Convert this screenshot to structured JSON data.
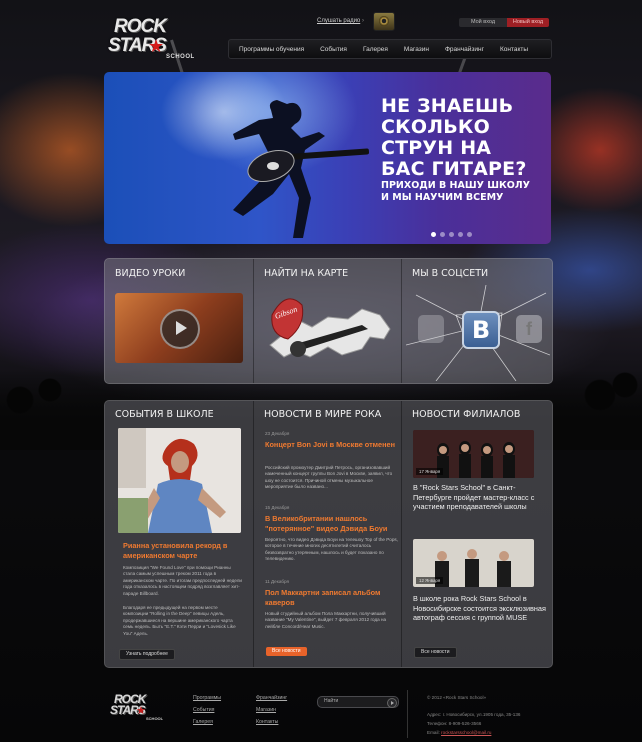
{
  "brand": {
    "logo_line1": "ROCK",
    "logo_line2": "STARS",
    "logo_school": "SCHOOL",
    "accent": "#f07a30",
    "red": "#9e1f24"
  },
  "header": {
    "radio_link": "Слушать радио",
    "auth_login": "Мой вход",
    "auth_register": "Новый вход",
    "nav": [
      "Программы обучения",
      "События",
      "Галерея",
      "Магазин",
      "Франчайзинг",
      "Контакты"
    ]
  },
  "hero": {
    "headline": [
      "НЕ ЗНАЕШЬ",
      "СКОЛЬКО",
      "СТРУН НА",
      "БАС ГИТАРЕ?"
    ],
    "subline": [
      "ПРИХОДИ В НАШУ ШКОЛУ",
      "И МЫ НАУЧИМ ВСЕМУ"
    ],
    "slides_total": 5,
    "active_slide": 1
  },
  "features": {
    "video_title": "ВИДЕО УРОКИ",
    "map_title": "НАЙТИ НА КАРТЕ",
    "social_title": "МЫ В СОЦСЕТИ",
    "map_badge": "Gibson",
    "vk_letter": "B",
    "fb_letter": "f"
  },
  "events": {
    "title": "СОБЫТИЯ В ШКОЛЕ",
    "item_title": "Рианна установила рекорд в американском чарте",
    "text1": "Композиция \"We Found Love\" при помощи Рианны стала самым успешным треком 2011 года в американском чарте. По итогам предпоследней недели года отказалось в настоящем подряд возглавляет хит-параде Billboard.",
    "text2": "Благодаря ее предыдущей на первом месте композиции \"Rolling in the Deep\" певицы Адель, продержавшиеся на вершине американского чарта семь недель. Быть \"E.T.\" Кэти Перри и \"Lovesick Like You\" Адель.",
    "button": "Узнать подробнее"
  },
  "news": {
    "title": "НОВОСТИ В МИРЕ РОКА",
    "items": [
      {
        "date": "23 Декабря",
        "title": "Концерт Bon Jovi в Москве отменен",
        "text": "Российский промоутер Дмитрий Петрось, организовавший намеченный концерт группы Bon Jovi в Москве, заявил, что шоу не состоится. Причиной отмены музыкальное мероприятие было названо..."
      },
      {
        "date": "15 Декабря",
        "title": "В Великобритании нашлось \"потерянное\" видео Дэвида Боуи",
        "text": "Вероятно, что видео Дэвида Боуи на телешоу Top of the Pops, которое в течение многих десятилетий считалось безвозвратно утерянным, нашлось и будет показано по телевидению."
      },
      {
        "date": "11 Декабря",
        "title": "Пол Маккартни записал альбом каверов",
        "text": "Новый студийный альбом Пола Маккартни, получивший название \"My Valentine\", выйдет 7 февраля 2012 года на лейбле Concord/Hear Music."
      }
    ],
    "button": "Все новости"
  },
  "branches": {
    "title": "НОВОСТИ ФИЛИАЛОВ",
    "items": [
      {
        "date": "17 Января",
        "title": "В \"Rock Stars School\" в Санкт-Петербурге пройдет мастер-класс с участием преподавателей школы"
      },
      {
        "date": "12 Января",
        "title": "В школе рока Rock Stars School в Новосибирске состоится эксклюзивная автограф сессия с группой MUSE"
      }
    ],
    "button": "Все новости"
  },
  "footer": {
    "col1": [
      "Программы",
      "События",
      "Галерея"
    ],
    "col2": [
      "Франчайзинг",
      "Магазин",
      "Контакты"
    ],
    "search_placeholder": "Найти",
    "copyright": "© 2012 «Rock Stars School»",
    "address": "Адрес: г. Новосибирск, ул.1905 года, 35-136",
    "phone": "Телефон: 8-909-526-3566",
    "email_label": "Email:",
    "email": "rockstarsschool@mail.ru"
  }
}
